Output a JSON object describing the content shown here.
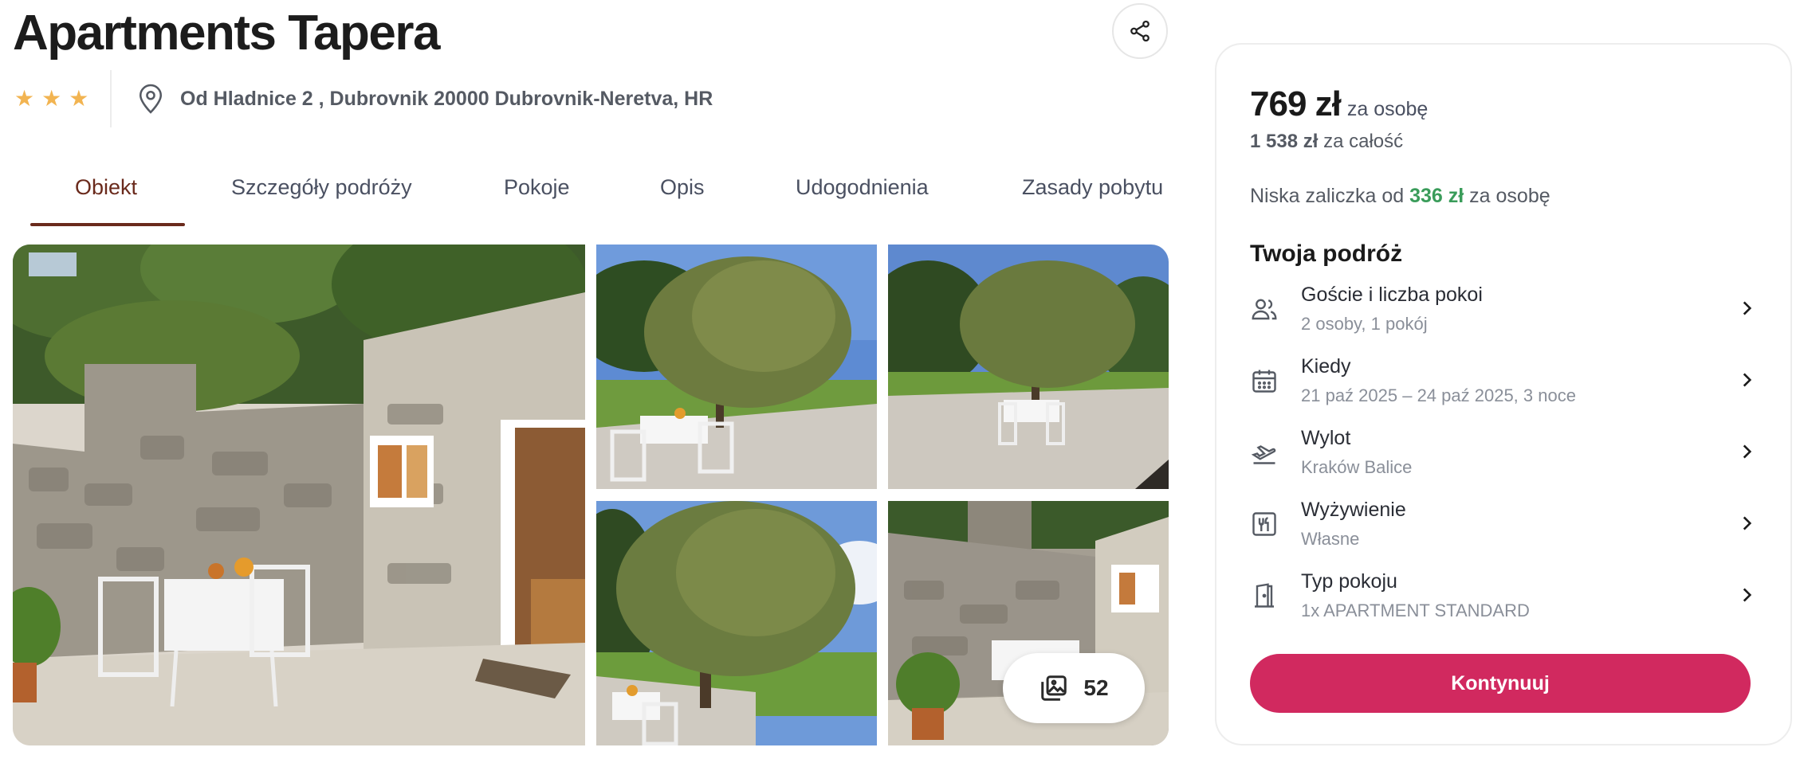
{
  "header": {
    "title": "Apartments Tapera",
    "stars": 3,
    "address": "Od Hladnice 2 , Dubrovnik 20000 Dubrovnik-Neretva, HR"
  },
  "tabs": [
    {
      "label": "Obiekt",
      "active": true
    },
    {
      "label": "Szczegóły podróży"
    },
    {
      "label": "Pokoje"
    },
    {
      "label": "Opis"
    },
    {
      "label": "Udogodnienia"
    },
    {
      "label": "Zasady pobytu"
    }
  ],
  "gallery": {
    "photo_count": "52"
  },
  "booking": {
    "price": "769 zł",
    "price_unit": "za osobę",
    "total_amount": "1 538 zł",
    "total_label": "za całość",
    "deposit_prefix": "Niska zaliczka od",
    "deposit_amount": "336 zł",
    "deposit_suffix": "za osobę",
    "trip_heading": "Twoja podróż",
    "rows": [
      {
        "icon": "guests-icon",
        "label": "Goście i liczba pokoi",
        "value": "2 osoby, 1 pokój"
      },
      {
        "icon": "calendar-icon",
        "label": "Kiedy",
        "value": "21 paź 2025 – 24 paź 2025, 3 noce"
      },
      {
        "icon": "plane-departure-icon",
        "label": "Wylot",
        "value": "Kraków Balice"
      },
      {
        "icon": "meal-icon",
        "label": "Wyżywienie",
        "value": "Własne"
      },
      {
        "icon": "door-icon",
        "label": "Typ pokoju",
        "value": "1x APARTMENT STANDARD"
      }
    ],
    "cta_label": "Kontynuuj"
  },
  "colors": {
    "accent": "#d1295f",
    "tab_active": "#6a2a1c",
    "deposit_green": "#3a9c5a",
    "star": "#f2b451"
  }
}
